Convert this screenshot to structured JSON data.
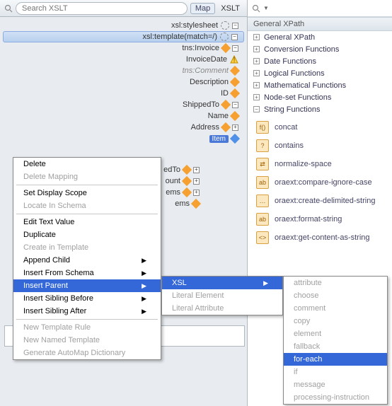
{
  "left": {
    "search_placeholder": "Search XSLT",
    "tab_map": "Map",
    "tab_xslt": "XSLT",
    "tree": [
      {
        "label": "xsl:stylesheet",
        "icon": "gear",
        "exp": "-"
      },
      {
        "label": "xsl:template(match=/)",
        "icon": "gear",
        "sel": true,
        "exp": "-"
      },
      {
        "label": "tns:Invoice",
        "icon": "diamond",
        "exp": "-"
      },
      {
        "label": "InvoiceDate",
        "icon": "warn"
      },
      {
        "label": "tns:Comment",
        "icon": "diamond",
        "italic": true
      },
      {
        "label": "Description",
        "icon": "diamond"
      },
      {
        "label": "ID",
        "icon": "diamond"
      },
      {
        "label": "ShippedTo",
        "icon": "diamond",
        "exp": "-"
      },
      {
        "label": "Name",
        "icon": "diamond"
      },
      {
        "label": "Address",
        "icon": "diamond",
        "exp": "+"
      },
      {
        "label": "Item",
        "icon": "blue",
        "badge": true
      }
    ],
    "tree_tail": [
      {
        "label": "edTo",
        "icon": "diamond",
        "exp": "+"
      },
      {
        "label": "ount",
        "icon": "diamond",
        "exp": "+"
      },
      {
        "label": "ems",
        "icon": "diamond",
        "exp": "+"
      },
      {
        "label": "ems",
        "icon": "diamond"
      }
    ]
  },
  "right": {
    "section": "General XPath",
    "categories": [
      "General XPath",
      "Conversion Functions",
      "Date Functions",
      "Logical Functions",
      "Mathematical Functions",
      "Node-set Functions",
      "String Functions"
    ],
    "functions": [
      {
        "label": "concat",
        "ico": "f()"
      },
      {
        "label": "contains",
        "ico": "?"
      },
      {
        "label": "normalize-space",
        "ico": "⇄"
      },
      {
        "label": "oraext:compare-ignore-case",
        "ico": "ab"
      },
      {
        "label": "oraext:create-delimited-string",
        "ico": "…"
      },
      {
        "label": "oraext:format-string",
        "ico": "ab"
      },
      {
        "label": "oraext:get-content-as-string",
        "ico": "<>"
      }
    ]
  },
  "menu1": [
    {
      "label": "Delete"
    },
    {
      "label": "Delete Mapping",
      "disabled": true
    },
    {
      "sep": true
    },
    {
      "label": "Set Display Scope"
    },
    {
      "label": "Locate In Schema",
      "disabled": true
    },
    {
      "sep": true
    },
    {
      "label": "Edit Text Value"
    },
    {
      "label": "Duplicate"
    },
    {
      "label": "Create in Template",
      "disabled": true
    },
    {
      "label": "Append Child",
      "arrow": true
    },
    {
      "label": "Insert From Schema",
      "arrow": true
    },
    {
      "label": "Insert Parent",
      "arrow": true,
      "highlight": true
    },
    {
      "label": "Insert Sibling Before",
      "arrow": true
    },
    {
      "label": "Insert Sibling After",
      "arrow": true
    },
    {
      "sep": true
    },
    {
      "label": "New Template Rule",
      "disabled": true
    },
    {
      "label": "New Named Template",
      "disabled": true
    },
    {
      "label": "Generate AutoMap Dictionary",
      "disabled": true
    }
  ],
  "menu2": [
    {
      "label": "XSL",
      "arrow": true,
      "highlight": true
    },
    {
      "label": "Literal Element",
      "disabled": true
    },
    {
      "label": "Literal Attribute",
      "disabled": true
    }
  ],
  "menu3": [
    {
      "label": "attribute",
      "disabled": true
    },
    {
      "label": "choose",
      "disabled": true
    },
    {
      "label": "comment",
      "disabled": true
    },
    {
      "label": "copy",
      "disabled": true
    },
    {
      "label": "element",
      "disabled": true
    },
    {
      "label": "fallback",
      "disabled": true
    },
    {
      "label": "for-each",
      "highlight": true
    },
    {
      "label": "if",
      "disabled": true
    },
    {
      "label": "message",
      "disabled": true
    },
    {
      "label": "processing-instruction",
      "disabled": true
    }
  ]
}
